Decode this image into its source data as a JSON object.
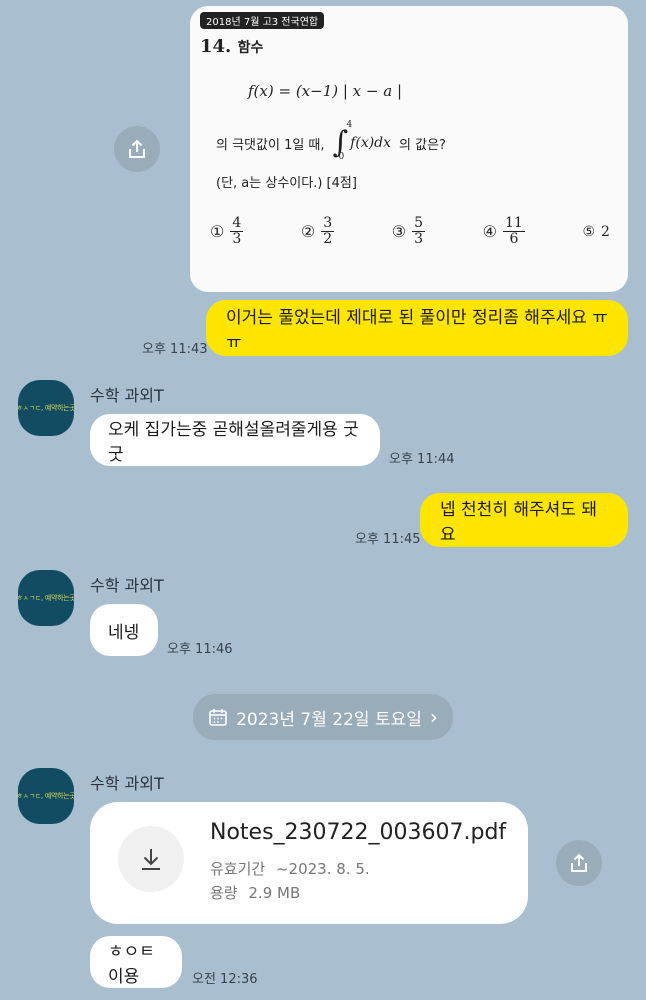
{
  "image_message": {
    "exam_tag": "2018년 7월 고3 전국연합",
    "question_number": "14.",
    "question_topic": "함수",
    "formula": "f(x) = (x−1) | x − a |",
    "condition_prefix": "의 극댓값이 1일 때,",
    "integral_upper": "4",
    "integral_lower": "0",
    "integral_body": "f(x)dx",
    "condition_suffix": "의 값은?",
    "note": "(단, a는 상수이다.) [4점]",
    "choices": [
      {
        "mark": "①",
        "num": "4",
        "den": "3"
      },
      {
        "mark": "②",
        "num": "3",
        "den": "2"
      },
      {
        "mark": "③",
        "num": "5",
        "den": "3"
      },
      {
        "mark": "④",
        "num": "11",
        "den": "6"
      },
      {
        "mark": "⑤",
        "value": "2"
      }
    ]
  },
  "messages": {
    "m1_text": "이거는 풀었는데 제대로 된 풀이만 정리좀 해주세요 ㅠㅠ",
    "m1_time": "오후 11:43",
    "m2_sender": "수학 과외T",
    "m2_text": "오케 집가는중 곧해설올려줄게용 굿굿",
    "m2_time": "오후 11:44",
    "m3_text": "넵 천천히 해주셔도 돼요",
    "m3_time": "오후 11:45",
    "m4_sender": "수학 과외T",
    "m4_text": "네넹",
    "m4_time": "오후 11:46",
    "m5_sender": "수학 과외T",
    "m6_text": "ㅎㅇㅌ이용",
    "m6_time": "오전 12:36"
  },
  "date_divider": {
    "label": "2023년 7월 22일 토요일",
    "icon": "calendar-icon",
    "arrow": "›"
  },
  "file_message": {
    "filename": "Notes_230722_003607.pdf",
    "expiry_label": "유효기간",
    "expiry_value": "~2023. 8. 5.",
    "size_label": "용량",
    "size_value": "2.9 MB"
  },
  "avatar_text": "ㅎㅅㄱㄷ, 예약하는곳",
  "colors": {
    "background": "#a9bfd0",
    "my_bubble": "#fee500",
    "their_bubble": "#ffffff",
    "avatar": "#114c63"
  }
}
